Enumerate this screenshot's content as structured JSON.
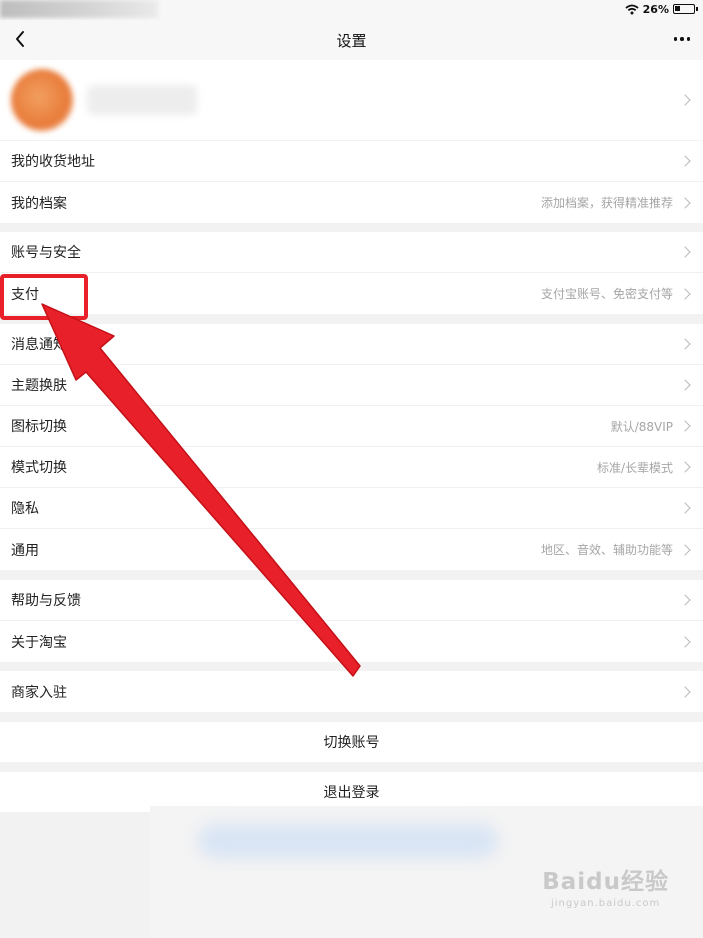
{
  "status_bar": {
    "battery": "26%"
  },
  "nav": {
    "title": "设置"
  },
  "profile": {},
  "groups": [
    {
      "rows": [
        {
          "label": "我的收货地址",
          "desc": ""
        },
        {
          "label": "我的档案",
          "desc": "添加档案，获得精准推荐"
        }
      ]
    },
    {
      "rows": [
        {
          "label": "账号与安全",
          "desc": ""
        },
        {
          "label": "支付",
          "desc": "支付宝账号、免密支付等"
        }
      ]
    },
    {
      "rows": [
        {
          "label": "消息通知",
          "desc": ""
        },
        {
          "label": "主题换肤",
          "desc": ""
        },
        {
          "label": "图标切换",
          "desc": "默认/88VIP"
        },
        {
          "label": "模式切换",
          "desc": "标准/长辈模式"
        },
        {
          "label": "隐私",
          "desc": ""
        },
        {
          "label": "通用",
          "desc": "地区、音效、辅助功能等"
        }
      ]
    },
    {
      "rows": [
        {
          "label": "帮助与反馈",
          "desc": ""
        },
        {
          "label": "关于淘宝",
          "desc": ""
        }
      ]
    },
    {
      "rows": [
        {
          "label": "商家入驻",
          "desc": ""
        }
      ]
    }
  ],
  "actions": {
    "switch_account": "切换账号",
    "logout": "退出登录"
  },
  "watermark": {
    "main": "Baidu经验",
    "sub": "jingyan.baidu.com"
  },
  "colors": {
    "highlight": "#e8202a",
    "background": "#f2f2f2"
  }
}
